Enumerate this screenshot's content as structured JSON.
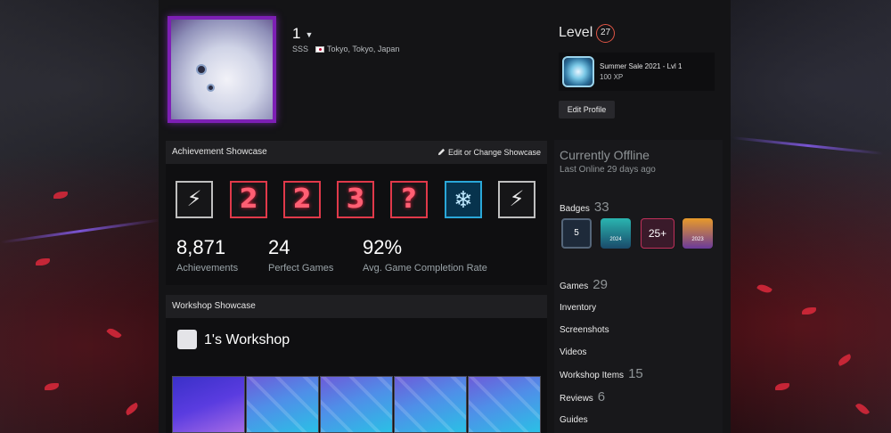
{
  "profile": {
    "persona_name": "1",
    "real_name": "SSS",
    "location": "Tokyo, Tokyo, Japan",
    "avatar_icon": "avatar-image",
    "frame_color": "#7d1fb5"
  },
  "level": {
    "label": "Level",
    "value": "27"
  },
  "favorite_badge": {
    "name": "Summer Sale 2021 - Lvl 1",
    "xp": "100 XP"
  },
  "edit_profile_label": "Edit Profile",
  "achievement_showcase": {
    "title": "Achievement Showcase",
    "edit_label": "Edit or Change Showcase",
    "icons": [
      {
        "name": "lightning-achievement-icon",
        "glyph": "⚡"
      },
      {
        "name": "number-2-achievement-icon",
        "glyph": "2"
      },
      {
        "name": "number-2-achievement-icon",
        "glyph": "2"
      },
      {
        "name": "number-3-achievement-icon",
        "glyph": "3"
      },
      {
        "name": "question-achievement-icon",
        "glyph": "?"
      },
      {
        "name": "snowflake-achievement-icon",
        "glyph": "❄"
      },
      {
        "name": "lightning-achievement-icon",
        "glyph": "⚡"
      }
    ],
    "stats": [
      {
        "value": "8,871",
        "label": "Achievements"
      },
      {
        "value": "24",
        "label": "Perfect Games"
      },
      {
        "value": "92%",
        "label": "Avg. Game Completion Rate"
      }
    ]
  },
  "workshop_showcase": {
    "title": "Workshop Showcase",
    "workshop_name": "1's Workshop"
  },
  "status": {
    "main": "Currently Offline",
    "sub": "Last Online 29 days ago"
  },
  "sidebar": {
    "badges": {
      "label": "Badges",
      "count": "33"
    },
    "badge_icons": [
      {
        "name": "badge-5-icon",
        "text": "5"
      },
      {
        "name": "steam-2024-badge-icon",
        "text": "2024"
      },
      {
        "name": "badge-25plus-icon",
        "text": "25+"
      },
      {
        "name": "steam-2023-badge-icon",
        "text": "2023"
      }
    ],
    "games": {
      "label": "Games",
      "count": "29"
    },
    "inventory": "Inventory",
    "screenshots": "Screenshots",
    "videos": "Videos",
    "workshop_items": {
      "label": "Workshop Items",
      "count": "15"
    },
    "reviews": {
      "label": "Reviews",
      "count": "6"
    },
    "guides": "Guides"
  }
}
